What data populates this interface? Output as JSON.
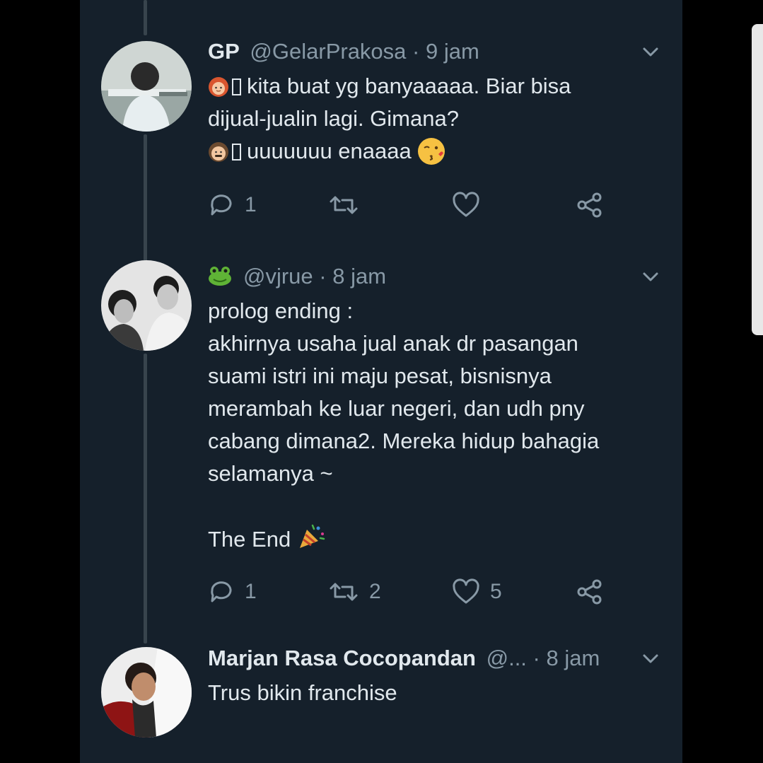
{
  "tweets": [
    {
      "name": "GP",
      "handle": "@GelarPrakosa",
      "sep": "·",
      "time": "9 jam",
      "lines": [
        "kita buat yg banyaaaaa. Biar bisa",
        "dijual-jualin lagi. Gimana?",
        "uuuuuuu enaaaa"
      ],
      "counts": {
        "reply": "1",
        "retweet": "",
        "like": ""
      }
    },
    {
      "name": "",
      "handle": "@vjrue",
      "sep": "·",
      "time": "8 jam",
      "lines": [
        "prolog ending :",
        "akhirnya usaha jual anak dr pasangan",
        "suami istri ini maju pesat, bisnisnya",
        "merambah ke luar negeri, dan udh pny",
        "cabang dimana2. Mereka hidup bahagia",
        "selamanya ~",
        "The End"
      ],
      "counts": {
        "reply": "1",
        "retweet": "2",
        "like": "5"
      }
    },
    {
      "name": "Marjan Rasa Cocopandan",
      "handle": "@...",
      "sep": "·",
      "time": "8 jam",
      "lines": [
        "Trus bikin franchise"
      ]
    }
  ],
  "icons": {
    "reply": "reply-icon",
    "retweet": "retweet-icon",
    "like": "heart-icon",
    "share": "share-icon",
    "more": "chevron-down-icon"
  },
  "colors": {
    "background": "#15202b",
    "outer": "#000000",
    "text_primary": "#e1e8ed",
    "text_secondary": "#8899a6",
    "thread_line": "#38444d"
  }
}
